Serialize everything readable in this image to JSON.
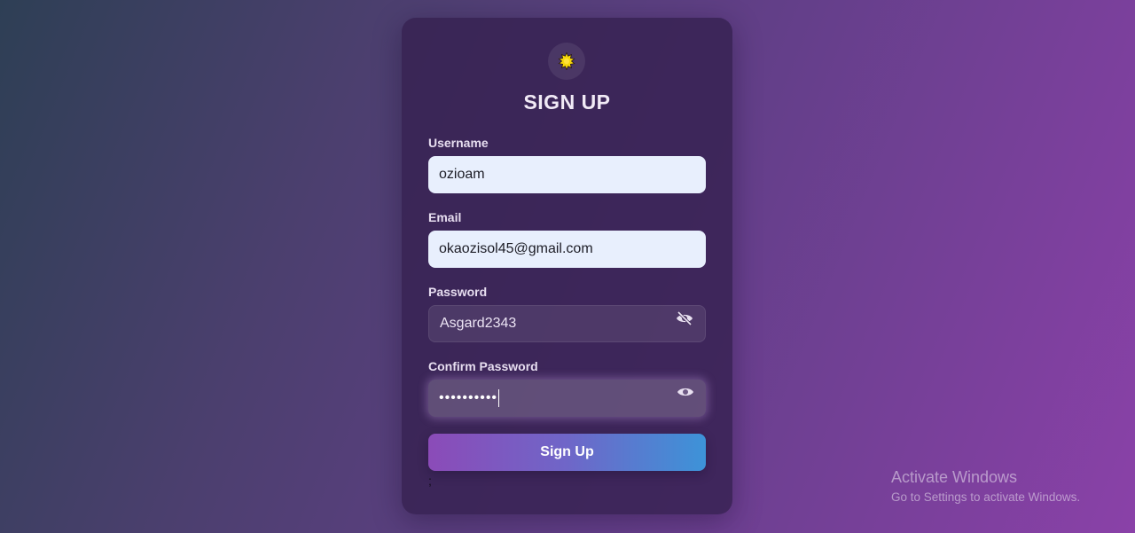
{
  "form": {
    "title": "SIGN UP",
    "logo_icon": "sun-icon",
    "fields": [
      {
        "label": "Username",
        "value": "ozioam"
      },
      {
        "label": "Email",
        "value": "okaozisol45@gmail.com"
      },
      {
        "label": "Password",
        "value": "Asgard2343",
        "toggle_icon": "eye-off-icon"
      },
      {
        "label": "Confirm Password",
        "value": "••••••••••",
        "toggle_icon": "eye-icon"
      }
    ],
    "submit_label": "Sign Up",
    "stray_text": ";"
  },
  "watermark": {
    "title": "Activate Windows",
    "subtitle": "Go to Settings to activate Windows."
  },
  "colors": {
    "input_light": "#e8effd",
    "button_start": "#8b4bb8",
    "button_end": "#3d93d8",
    "logo_sun": "#f5d60a"
  }
}
